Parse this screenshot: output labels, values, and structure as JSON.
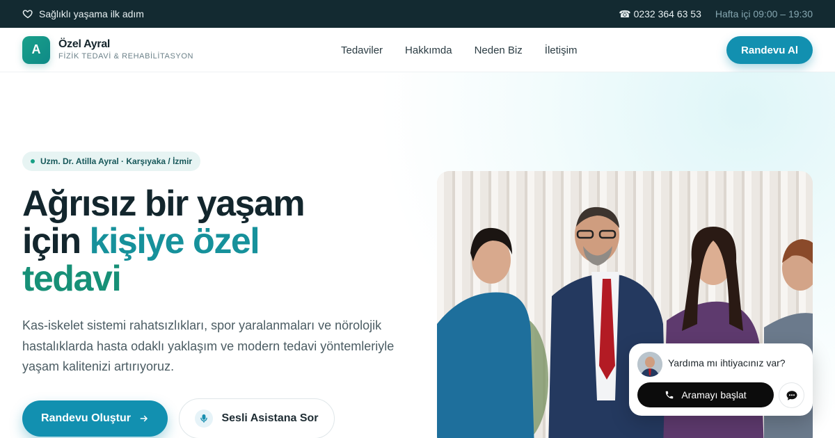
{
  "topbar": {
    "tagline": "Sağlıklı yaşama ilk adım",
    "phone": "☎ 0232 364 63 53",
    "hours": "Hafta içi 09:00 – 19:30"
  },
  "header": {
    "logo_letter": "A",
    "brand_name": "Özel Ayral",
    "brand_sub": "FİZİK TEDAVİ & REHABİLİTASYON",
    "nav": [
      "Tedaviler",
      "Hakkımda",
      "Neden Biz",
      "İletişim"
    ],
    "cta": "Randevu Al"
  },
  "hero": {
    "badge": "Uzm. Dr. Atilla Ayral · Karşıyaka / İzmir",
    "headline_part1": "Ağrısız bir yaşam",
    "headline_part2": "için ",
    "headline_accent1": "kişiye özel",
    "headline_accent2": "tedavi",
    "lead": "Kas-iskelet sistemi rahatsızlıkları, spor yaralanmaları ve nörolojik hastalıklarda hasta odaklı yaklaşım ve modern tedavi yöntemleriyle yaşam kalitenizi artırıyoruz.",
    "primary_button": "Randevu Oluştur",
    "secondary_button": "Sesli Asistana Sor"
  },
  "chat_widget": {
    "question": "Yardıma mı ihtiyacınız var?",
    "call_button": "Aramayı başlat"
  },
  "colors": {
    "topbar": "#132a31",
    "primary": "#1290b0",
    "accent_teal": "#16919b",
    "accent_green": "#179077"
  }
}
